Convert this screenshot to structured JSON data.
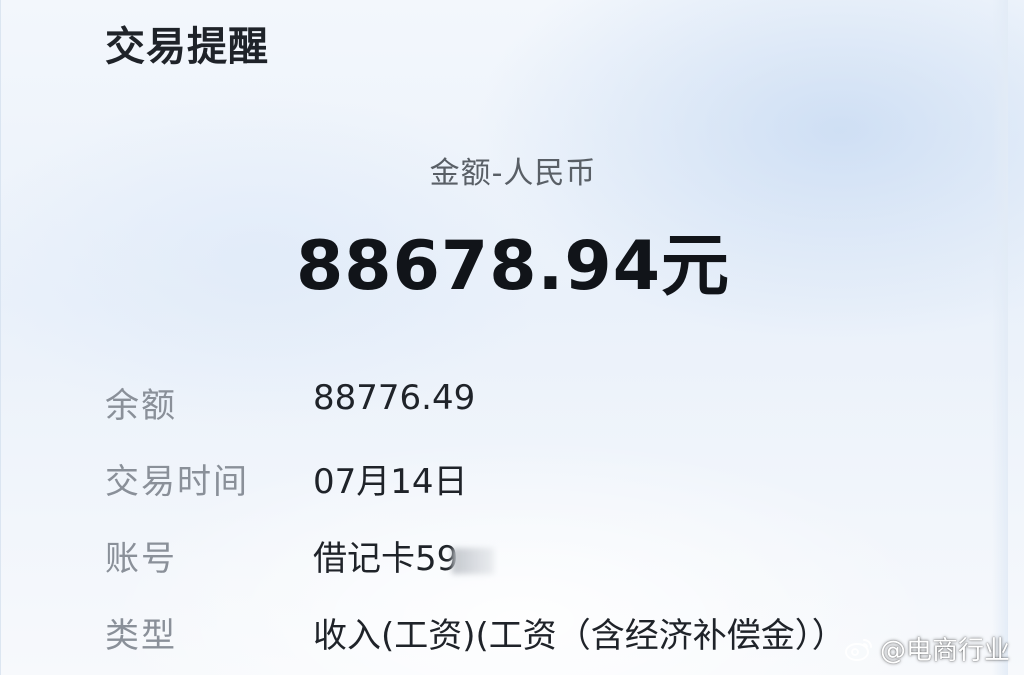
{
  "header": {
    "title": "交易提醒"
  },
  "amount": {
    "caption": "金额-人民币",
    "value": "88678.94元"
  },
  "details": {
    "balance": {
      "label": "余额",
      "value": "88776.49"
    },
    "time": {
      "label": "交易时间",
      "value": "07月14日"
    },
    "account": {
      "label": "账号",
      "value": "借记卡59"
    },
    "type": {
      "label": "类型",
      "value": "收入(工资)(工资（含经济补偿金））"
    }
  },
  "watermark": {
    "text": "@电商行业",
    "icon": "weibo-icon"
  },
  "colors": {
    "background": "#eef4fb",
    "label": "#8a9099",
    "value": "#1f2329"
  }
}
